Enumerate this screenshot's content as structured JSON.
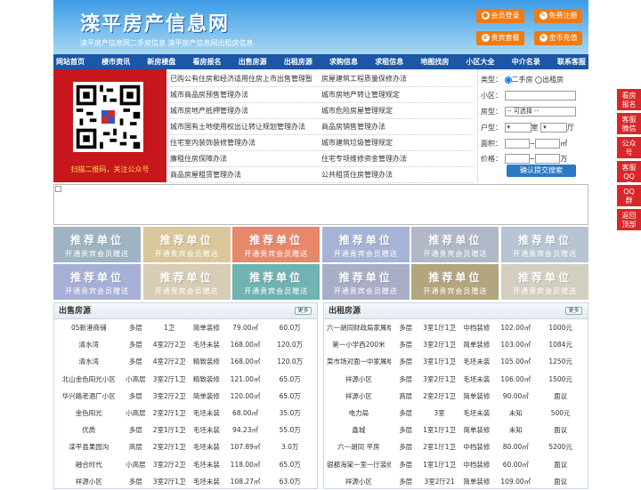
{
  "site": {
    "title": "滦平房产信息网",
    "subtitle": "滦平房产信息网二手房信息    滦平房产信息网出租房信息"
  },
  "header_buttons": [
    {
      "label": "会员登录",
      "icon": "user-icon"
    },
    {
      "label": "免费注册",
      "icon": "pencil-icon"
    },
    {
      "label": "贵宾套餐",
      "icon": "crown-icon"
    },
    {
      "label": "金币充值",
      "icon": "coin-icon"
    }
  ],
  "nav": [
    "网站首页",
    "楼市资讯",
    "新房楼盘",
    "看房报名",
    "出售房源",
    "出租房源",
    "求购信息",
    "求租信息",
    "地图找房",
    "小区大全",
    "中介名录",
    "联系客服"
  ],
  "qr": {
    "caption": "扫描二维码，关注公众号"
  },
  "policy_links": [
    [
      "已购公有住房和经济适用住房上市出售管理暂",
      "房屋建筑工程质量保修办法"
    ],
    [
      "城市商品房预售管理办法",
      "城市房地产转让管理规定"
    ],
    [
      "城市房地产抵押管理办法",
      "城市危险房屋管理规定"
    ],
    [
      "城市国有土地使用权出让转让规划管理办法",
      "商品房销售管理办法"
    ],
    [
      "住宅室内装饰装修管理办法",
      "城市建筑垃圾管理规定"
    ],
    [
      "廉租住房保障办法",
      "住宅专项维修资金管理办法"
    ],
    [
      "商品房屋租赁管理办法",
      "公共租赁住房管理办法"
    ]
  ],
  "search": {
    "type_label": "类型：",
    "type_options": [
      "二手房",
      "出租房"
    ],
    "community_label": "小区：",
    "housetype_label": "房型：",
    "housetype_value": "-- 可选择 --",
    "layout_label": "户型：",
    "room_unit": "室",
    "hall_unit": "厅",
    "area_label": "面积：",
    "area_unit": "㎡",
    "area_sep": "~",
    "price_label": "价格：",
    "price_unit": "万",
    "price_sep": "~",
    "submit": "确认提交搜索"
  },
  "ads": {
    "title": "推荐单位",
    "line": "开通贵宾会员赠送",
    "colors": [
      "#9fb4c2",
      "#d9c79a",
      "#e9876b",
      "#a7b3d6",
      "#b1b8c8",
      "#b7c4d3",
      "#a6b0d6",
      "#d6cdb4",
      "#6fb3b2",
      "#a8aec6",
      "#b3a67e",
      "#d3cfc0"
    ]
  },
  "sale": {
    "title": "出售房源",
    "more": "更多",
    "rows": [
      [
        "05新港商铺",
        "多层",
        "1卫",
        "简单装修",
        "79.00㎡",
        "60.0万"
      ],
      [
        "清水湾",
        "多层",
        "4室2厅2卫",
        "毛坯未装",
        "168.00㎡",
        "120.0万"
      ],
      [
        "清水湾",
        "多层",
        "4室2厅2卫",
        "精致装修",
        "168.00㎡",
        "120.0万"
      ],
      [
        "北山金色阳光小区",
        "小高层",
        "3室2厅1卫",
        "精致装修",
        "121.00㎡",
        "65.0万"
      ],
      [
        "华兴路老酒厂小区",
        "多层",
        "3室2厅2卫",
        "简单装修",
        "120.00㎡",
        "65.0万"
      ],
      [
        "金色阳光",
        "小高层",
        "2室2厅1卫",
        "毛坯未装",
        "68.00㎡",
        "35.0万"
      ],
      [
        "优质",
        "多层",
        "2室1厅1卫",
        "毛坯未装",
        "94.23㎡",
        "55.0万"
      ],
      [
        "滦平县果园沟",
        "高层",
        "2室2厅1卫",
        "毛坯未装",
        "107.89㎡",
        "3.0万"
      ],
      [
        "融合时代",
        "小高层",
        "3室2厅2卫",
        "毛坯未装",
        "118.00㎡",
        "65.0万"
      ],
      [
        "祥源小区",
        "多层",
        "3室2厅1卫",
        "毛坯未装",
        "108.27㎡",
        "63.0万"
      ]
    ]
  },
  "rent": {
    "title": "出租房源",
    "more": "更多",
    "rows": [
      [
        "六一胡同财政局家属楼",
        "多层",
        "3室1厅1卫",
        "中档装修",
        "102.00㎡",
        "1000元"
      ],
      [
        "第一小学西200米",
        "多层",
        "3室2厅1卫",
        "简单装修",
        "103.00㎡",
        "1084元"
      ],
      [
        "菜市场对面一中家属楼",
        "多层",
        "3室1厅1卫",
        "毛坯未装",
        "105.00㎡",
        "1250元"
      ],
      [
        "祥源小区",
        "多层",
        "3室2厅1卫",
        "毛坯未装",
        "106.00㎡",
        "1500元"
      ],
      [
        "祥源小区",
        "高层",
        "2室2厅1卫",
        "简单装修",
        "90.00㎡",
        "面议"
      ],
      [
        "电力局",
        "多层",
        "3室",
        "毛坯未装",
        "未知",
        "500元"
      ],
      [
        "鑫城",
        "多层",
        "1室1厅1卫",
        "简单装修",
        "未知",
        "面议"
      ],
      [
        "六一胡同 平房",
        "多层",
        "2室1厅1卫",
        "中档装修",
        "80.00㎡",
        "5200元"
      ],
      [
        "银都海棠一室一厅装修",
        "多层",
        "1室1厅1卫",
        "中档装修",
        "60.00㎡",
        "面议"
      ],
      [
        "祥源小区",
        "多层",
        "3室2厅21",
        "简单装修",
        "109.00㎡",
        "面议"
      ]
    ]
  },
  "side_buttons": [
    "看房报名",
    "客服微信",
    "公众号",
    "客服QQ号",
    "QQ群",
    "返回顶部"
  ]
}
